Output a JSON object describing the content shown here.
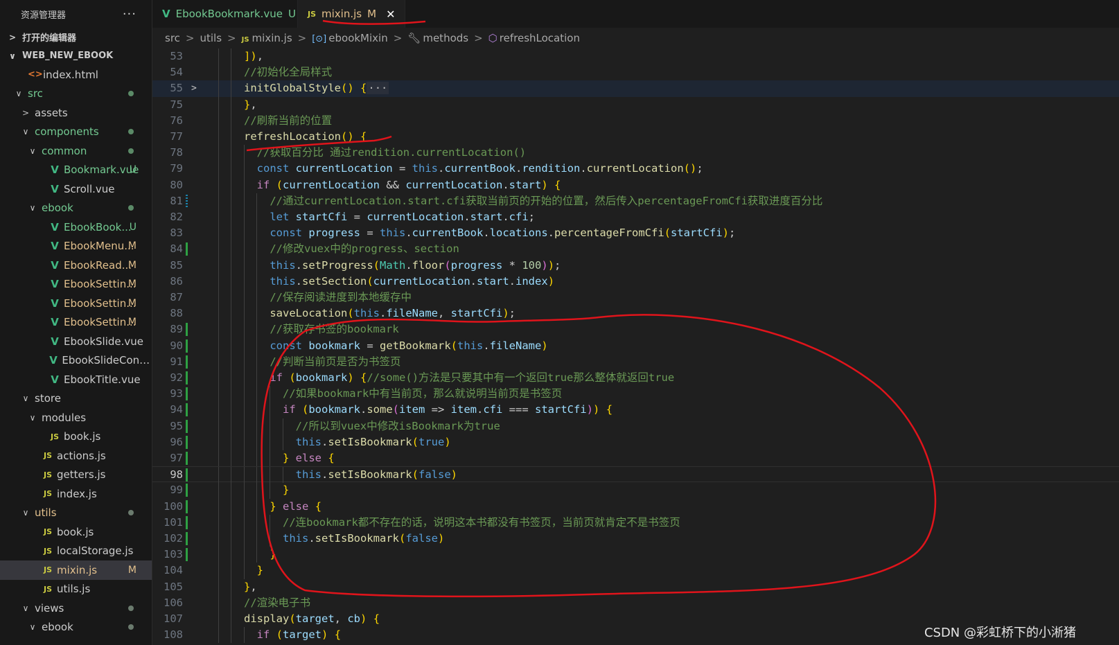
{
  "explorer": {
    "title": "资源管理器",
    "more": "···",
    "open_editors": "打开的编辑器",
    "project": "WEB_NEW_EBOOK",
    "items": [
      {
        "label": "index.html",
        "icon": "html",
        "indent": 1,
        "twist": ""
      },
      {
        "label": "src",
        "icon": "",
        "indent": 1,
        "twist": "v",
        "dot": true,
        "color": "green"
      },
      {
        "label": "assets",
        "icon": "",
        "indent": 2,
        "twist": ">"
      },
      {
        "label": "components",
        "icon": "",
        "indent": 2,
        "twist": "v",
        "dot": true,
        "color": "green"
      },
      {
        "label": "common",
        "icon": "",
        "indent": 3,
        "twist": "v",
        "dot": true,
        "color": "green"
      },
      {
        "label": "Bookmark.vue",
        "icon": "vue",
        "indent": 4,
        "badge": "U",
        "color": "green"
      },
      {
        "label": "Scroll.vue",
        "icon": "vue",
        "indent": 4
      },
      {
        "label": "ebook",
        "icon": "",
        "indent": 3,
        "twist": "v",
        "dot": true,
        "color": "green"
      },
      {
        "label": "EbookBook...",
        "icon": "vue",
        "indent": 4,
        "badge": "U",
        "color": "green"
      },
      {
        "label": "EbookMenu...",
        "icon": "vue",
        "indent": 4,
        "badge": "M",
        "color": "mod"
      },
      {
        "label": "EbookRead...",
        "icon": "vue",
        "indent": 4,
        "badge": "M",
        "color": "mod"
      },
      {
        "label": "EbookSettin...",
        "icon": "vue",
        "indent": 4,
        "badge": "M",
        "color": "mod"
      },
      {
        "label": "EbookSettin...",
        "icon": "vue",
        "indent": 4,
        "badge": "M",
        "color": "mod"
      },
      {
        "label": "EbookSettin...",
        "icon": "vue",
        "indent": 4,
        "badge": "M",
        "color": "mod"
      },
      {
        "label": "EbookSlide.vue",
        "icon": "vue",
        "indent": 4
      },
      {
        "label": "EbookSlideConte...",
        "icon": "vue",
        "indent": 4
      },
      {
        "label": "EbookTitle.vue",
        "icon": "vue",
        "indent": 4
      },
      {
        "label": "store",
        "icon": "",
        "indent": 2,
        "twist": "v"
      },
      {
        "label": "modules",
        "icon": "",
        "indent": 3,
        "twist": "v"
      },
      {
        "label": "book.js",
        "icon": "js",
        "indent": 4
      },
      {
        "label": "actions.js",
        "icon": "js",
        "indent": 3
      },
      {
        "label": "getters.js",
        "icon": "js",
        "indent": 3
      },
      {
        "label": "index.js",
        "icon": "js",
        "indent": 3
      },
      {
        "label": "utils",
        "icon": "",
        "indent": 2,
        "twist": "v",
        "dot": true,
        "color": "mod"
      },
      {
        "label": "book.js",
        "icon": "js",
        "indent": 3
      },
      {
        "label": "localStorage.js",
        "icon": "js",
        "indent": 3
      },
      {
        "label": "mixin.js",
        "icon": "js",
        "indent": 3,
        "badge": "M",
        "color": "mod",
        "selected": true
      },
      {
        "label": "utils.js",
        "icon": "js",
        "indent": 3
      },
      {
        "label": "views",
        "icon": "",
        "indent": 2,
        "twist": "v",
        "dot": true
      },
      {
        "label": "ebook",
        "icon": "",
        "indent": 3,
        "twist": "v",
        "dot": true
      }
    ]
  },
  "tabs": [
    {
      "label": "EbookBookmark.vue",
      "icon": "V",
      "badge": "U",
      "active": false
    },
    {
      "label": "mixin.js",
      "icon": "JS",
      "badge": "M",
      "active": true,
      "close": "✕"
    }
  ],
  "breadcrumb": [
    "src",
    "utils",
    "mixin.js",
    "ebookMixin",
    "methods",
    "refreshLocation"
  ],
  "code_lines": [
    {
      "n": "53",
      "t": "      ]),"
    },
    {
      "n": "54",
      "t": "      //初始化全局样式"
    },
    {
      "n": "55",
      "t": "      initGlobalStyle() {···",
      "fold": true,
      "hl": true
    },
    {
      "n": "75",
      "t": "      },"
    },
    {
      "n": "76",
      "t": "      //刷新当前的位置"
    },
    {
      "n": "77",
      "t": "      refreshLocation() {"
    },
    {
      "n": "78",
      "t": "        //获取百分比 通过rendition.currentLocation()"
    },
    {
      "n": "79",
      "t": "        const currentLocation = this.currentBook.rendition.currentLocation();"
    },
    {
      "n": "80",
      "t": "        if (currentLocation && currentLocation.start) {"
    },
    {
      "n": "81",
      "t": "          //通过currentLocation.start.cfi获取当前页的开始的位置，然后传入percentageFromCfi获取进度百分比",
      "mark": "dash"
    },
    {
      "n": "82",
      "t": "          let startCfi = currentLocation.start.cfi;"
    },
    {
      "n": "83",
      "t": "          const progress = this.currentBook.locations.percentageFromCfi(startCfi);"
    },
    {
      "n": "84",
      "t": "          //修改vuex中的progress、section",
      "mark": "add"
    },
    {
      "n": "85",
      "t": "          this.setProgress(Math.floor(progress * 100));"
    },
    {
      "n": "86",
      "t": "          this.setSection(currentLocation.start.index)"
    },
    {
      "n": "87",
      "t": "          //保存阅读进度到本地缓存中"
    },
    {
      "n": "88",
      "t": "          saveLocation(this.fileName, startCfi);"
    },
    {
      "n": "89",
      "t": "          //获取存书签的bookmark",
      "mark": "add"
    },
    {
      "n": "90",
      "t": "          const bookmark = getBookmark(this.fileName)",
      "mark": "add"
    },
    {
      "n": "91",
      "t": "          //判断当前页是否为书签页",
      "mark": "add"
    },
    {
      "n": "92",
      "t": "          if (bookmark) {//some()方法是只要其中有一个返回true那么整体就返回true",
      "mark": "add"
    },
    {
      "n": "93",
      "t": "            //如果bookmark中有当前页，那么就说明当前页是书签页",
      "mark": "add"
    },
    {
      "n": "94",
      "t": "            if (bookmark.some(item => item.cfi === startCfi)) {",
      "mark": "add"
    },
    {
      "n": "95",
      "t": "              //所以到vuex中修改isBookmark为true",
      "mark": "add"
    },
    {
      "n": "96",
      "t": "              this.setIsBookmark(true)",
      "mark": "add"
    },
    {
      "n": "97",
      "t": "            } else {",
      "mark": "add"
    },
    {
      "n": "98",
      "t": "              this.setIsBookmark(false)",
      "mark": "add",
      "cur": true
    },
    {
      "n": "99",
      "t": "            }",
      "mark": "add"
    },
    {
      "n": "100",
      "t": "          } else {",
      "mark": "add"
    },
    {
      "n": "101",
      "t": "            //连bookmark都不存在的话，说明这本书都没有书签页，当前页就肯定不是书签页",
      "mark": "add"
    },
    {
      "n": "102",
      "t": "            this.setIsBookmark(false)",
      "mark": "add"
    },
    {
      "n": "103",
      "t": "          }",
      "mark": "add"
    },
    {
      "n": "104",
      "t": "        }"
    },
    {
      "n": "105",
      "t": "      },"
    },
    {
      "n": "106",
      "t": "      //渲染电子书"
    },
    {
      "n": "107",
      "t": "      display(target, cb) {"
    },
    {
      "n": "108",
      "t": "        if (target) {"
    }
  ],
  "watermark": "CSDN @彩虹桥下的小淅猪",
  "colors": {
    "annotation": "#e0141b",
    "vue": "#41b883",
    "js": "#cbcb41",
    "untracked": "#73c991",
    "modified": "#e2c08d"
  }
}
